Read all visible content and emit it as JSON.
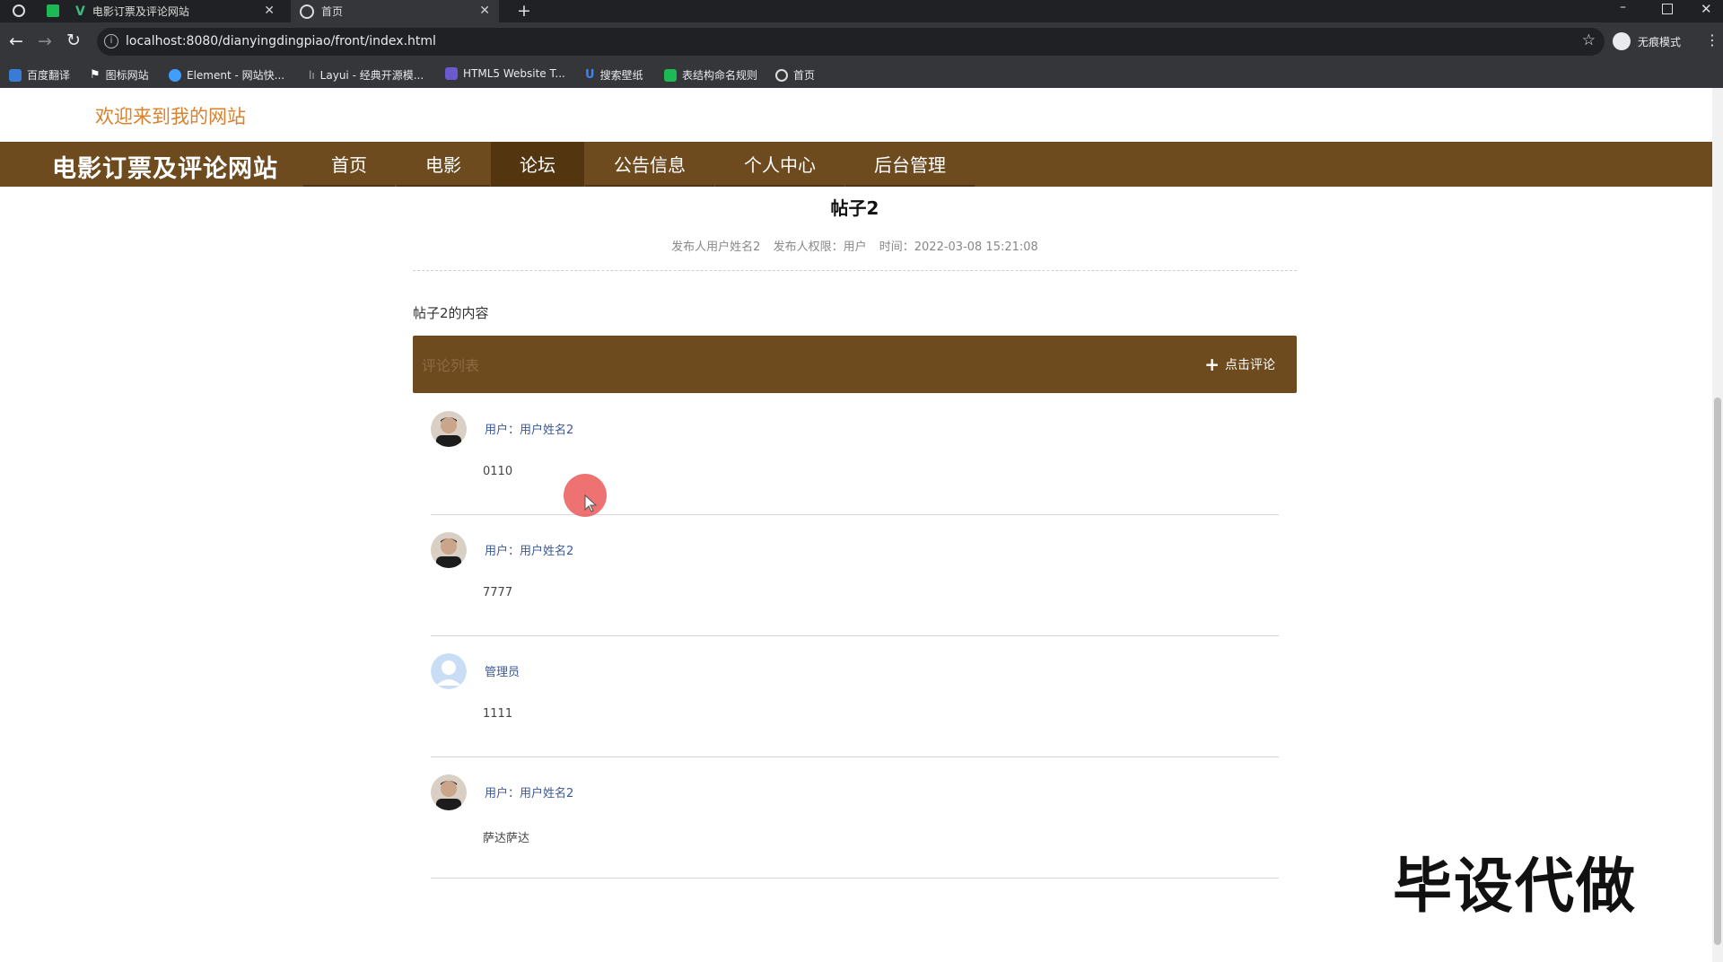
{
  "browser": {
    "tabs": [
      {
        "title": "电影订票及评论网站"
      },
      {
        "title": "首页"
      }
    ],
    "address": "localhost:8080/dianyingdingpiao/front/index.html",
    "profile_label": "无痕模式",
    "bookmarks": [
      {
        "label": "百度翻译",
        "color": "#3a7bd5"
      },
      {
        "label": "图标网站",
        "color": "#ffffff"
      },
      {
        "label": "Element - 网站快...",
        "color": "#409eff"
      },
      {
        "label": "Layui - 经典开源模...",
        "color": "#aaaaaa"
      },
      {
        "label": "HTML5 Website T...",
        "color": "#6a5acd"
      },
      {
        "label": "搜索壁纸",
        "color": "#3b82f6"
      },
      {
        "label": "表结构命名规则",
        "color": "#1db954"
      },
      {
        "label": "首页",
        "color": "#dddddd"
      }
    ]
  },
  "site": {
    "welcome": "欢迎来到我的网站",
    "title": "电影订票及评论网站",
    "nav": [
      "首页",
      "电影",
      "论坛",
      "公告信息",
      "个人中心",
      "后台管理"
    ],
    "active_nav": "论坛",
    "brand_color": "#6e4a1f"
  },
  "post": {
    "title": "帖子2",
    "meta": {
      "author": "发布人用户姓名2",
      "role": "发布人权限：用户",
      "time": "时间：2022-03-08 15:21:08"
    },
    "content": "帖子2的内容"
  },
  "comments": {
    "label": "评论列表",
    "add_label": "点击评论",
    "items": [
      {
        "user": "用户：用户姓名2",
        "text": "0110",
        "avatar": "photo"
      },
      {
        "user": "用户：用户姓名2",
        "text": "7777",
        "avatar": "photo"
      },
      {
        "user": "管理员",
        "text": "1111",
        "avatar": "default"
      },
      {
        "user": "用户：用户姓名2",
        "text": "萨达萨达",
        "avatar": "photo"
      }
    ]
  },
  "watermark": "毕设代做"
}
